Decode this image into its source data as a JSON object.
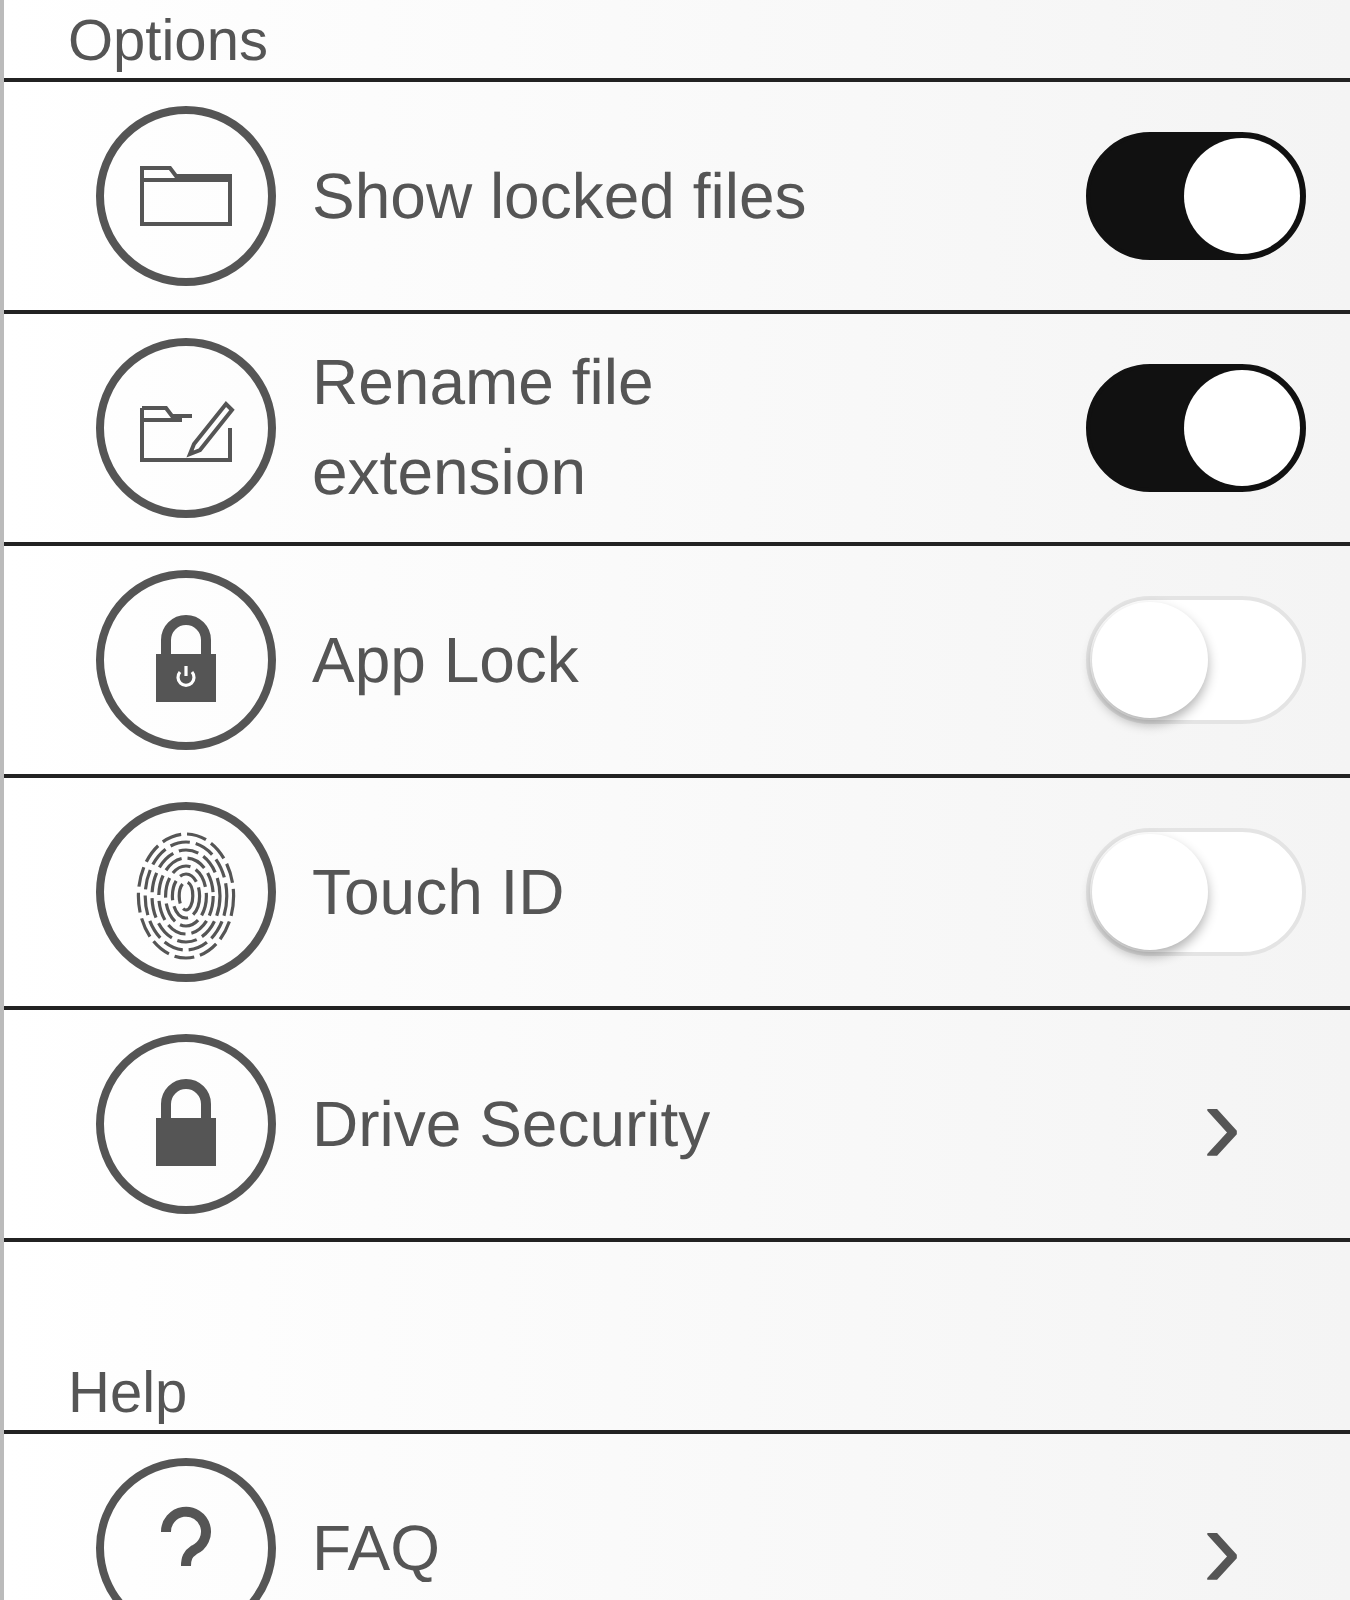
{
  "sections": [
    {
      "title": "Options",
      "items": [
        {
          "kind": "toggle",
          "label": "Show locked files",
          "on": true
        },
        {
          "kind": "toggle",
          "label": "Rename file extension",
          "on": true
        },
        {
          "kind": "toggle",
          "label": "App Lock",
          "on": false
        },
        {
          "kind": "toggle",
          "label": "Touch ID",
          "on": false
        },
        {
          "kind": "link",
          "label": "Drive Security",
          "chevron": "›"
        }
      ]
    },
    {
      "title": "Help",
      "items": [
        {
          "kind": "link",
          "label": "FAQ",
          "chevron": "›"
        }
      ]
    }
  ]
}
